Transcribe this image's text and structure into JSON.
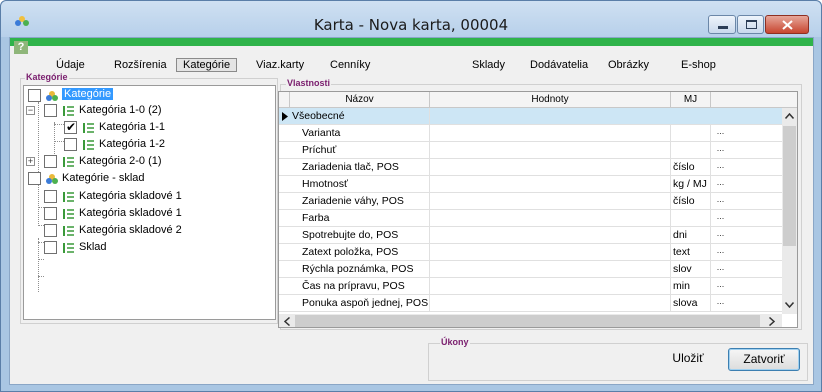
{
  "window": {
    "title": "Karta - Nova karta, 00004"
  },
  "toolbar": {
    "help_label": "?",
    "tabs": [
      {
        "label": "Údaje"
      },
      {
        "label": "Rozšírenia"
      },
      {
        "label": "Kategórie"
      },
      {
        "label": "Viaz.karty"
      },
      {
        "label": "Cenníky"
      },
      {
        "label": "Sklady"
      },
      {
        "label": "Dodávatelia"
      },
      {
        "label": "Obrázky"
      },
      {
        "label": "E-shop"
      }
    ],
    "active_tab": "Kategórie"
  },
  "categories_panel": {
    "label": "Kategórie",
    "tree": [
      {
        "label": "Kategórie",
        "checked": false,
        "selected": true,
        "icon": "categories-root-icon"
      },
      {
        "label": "Kategória 1-0 (2)",
        "checked": false,
        "icon": "category-icon",
        "expander": "−"
      },
      {
        "label": "Kategória 1-1",
        "checked": true,
        "icon": "category-icon"
      },
      {
        "label": "Kategória 1-2",
        "checked": false,
        "icon": "category-icon"
      },
      {
        "label": "Kategória 2-0 (1)",
        "checked": false,
        "icon": "category-icon",
        "expander": "+"
      },
      {
        "label": "Kategórie - sklad",
        "checked": false,
        "icon": "categories-root-icon"
      },
      {
        "label": "Kategória skladové 1",
        "checked": false,
        "icon": "category-icon"
      },
      {
        "label": "Kategória skladové 1",
        "checked": false,
        "icon": "category-icon"
      },
      {
        "label": "Kategória skladové 2",
        "checked": false,
        "icon": "category-icon"
      },
      {
        "label": "Sklad",
        "checked": false,
        "icon": "category-icon"
      }
    ]
  },
  "properties_panel": {
    "label": "Vlastnosti",
    "columns": {
      "name": "Názov",
      "value": "Hodnoty",
      "unit": "MJ"
    },
    "group_row": "Všeobecné",
    "ellipsis": "...",
    "rows": [
      {
        "name": "Varianta",
        "unit": ""
      },
      {
        "name": "Príchuť",
        "unit": ""
      },
      {
        "name": "Zariadenia tlač, POS",
        "unit": "číslo"
      },
      {
        "name": "Hmotnosť",
        "unit": "kg / MJ"
      },
      {
        "name": "Zariadenie váhy, POS",
        "unit": "číslo"
      },
      {
        "name": "Farba",
        "unit": ""
      },
      {
        "name": "Spotrebujte do, POS",
        "unit": "dni"
      },
      {
        "name": "Zatext položka, POS",
        "unit": "text"
      },
      {
        "name": "Rýchla poznámka, POS",
        "unit": "slov"
      },
      {
        "name": "Čas na prípravu, POS",
        "unit": "min"
      },
      {
        "name": "Ponuka aspoň jednej, POS",
        "unit": "slova"
      }
    ]
  },
  "actions_panel": {
    "label": "Úkony",
    "save_label": "Uložiť",
    "close_label": "Zatvoriť"
  },
  "colors": {
    "accent_green": "#2fb34a",
    "selection_blue": "#3399ff",
    "group_row_bg": "#cde6f5",
    "label_purple": "#7a1e6e"
  }
}
